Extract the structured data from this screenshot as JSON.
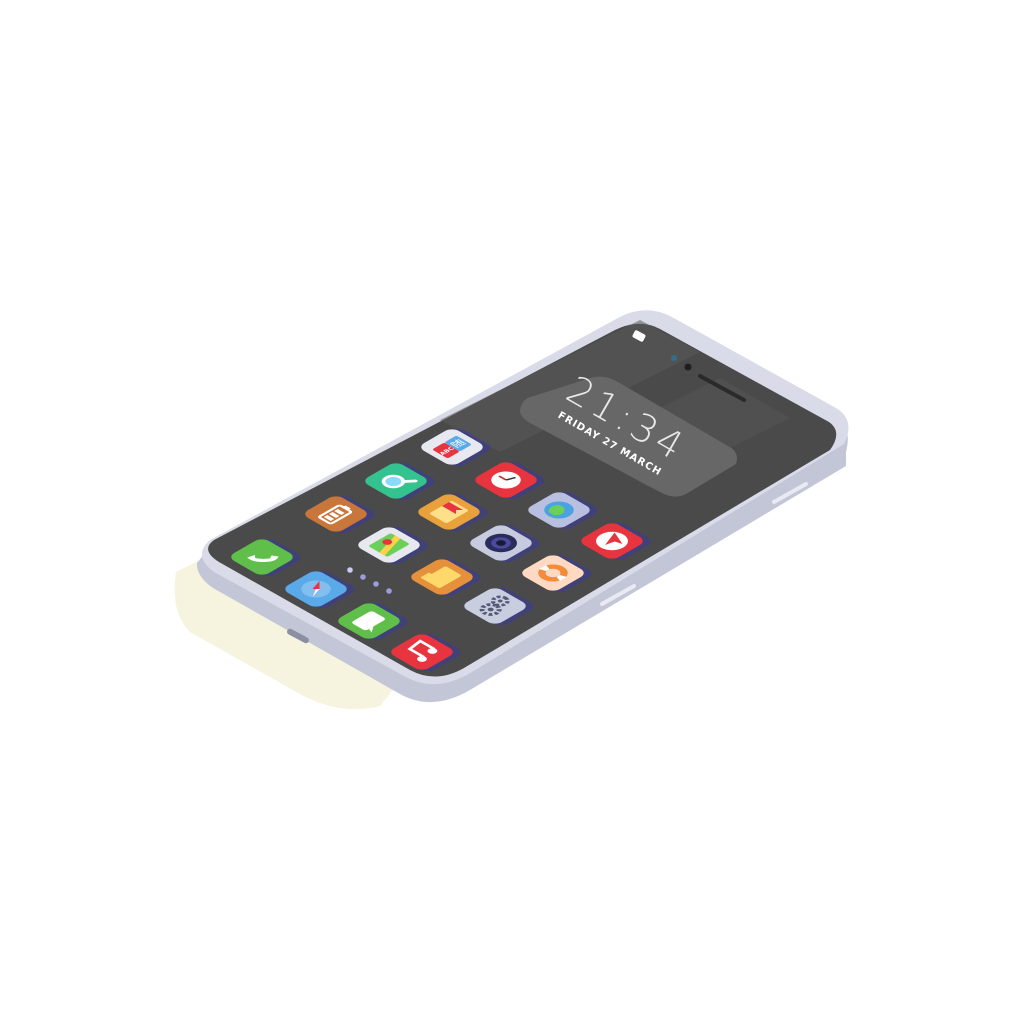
{
  "lock_widget": {
    "time": "21:34",
    "date": "FRIDAY 27 MARCH"
  },
  "translate_icon_text": {
    "latin": "ABC",
    "glyph": "随"
  },
  "colors": {
    "background": "#ffffff",
    "body_frame": "#d9dbe8",
    "body_edge": "#c3c6d6",
    "screen": "#4a4a4a",
    "shadow": "#f6f3de"
  },
  "page_indicator": {
    "dots": 4,
    "active": 0
  },
  "apps": [
    {
      "icon": "translate-icon",
      "bg": "#e8e8f0"
    },
    {
      "icon": "search-icon",
      "bg": "#34c38f"
    },
    {
      "icon": "clock-icon",
      "bg": "#e8343f"
    },
    {
      "icon": "battery-icon",
      "bg": "#c8763a"
    },
    {
      "icon": "bookmark-icon",
      "bg": "#e9a13b"
    },
    {
      "icon": "globe-icon",
      "bg": "#b9bfe0"
    },
    {
      "icon": "maps-icon",
      "bg": "#e8e8f0"
    },
    {
      "icon": "camera-icon",
      "bg": "#c7cbe0"
    },
    {
      "icon": "send-icon",
      "bg": "#e8343f"
    },
    {
      "icon": "phone-icon",
      "bg": "#5fbf4a"
    },
    {
      "icon": "folder-icon",
      "bg": "#e5903a"
    },
    {
      "icon": "lifebuoy-icon",
      "bg": "#ffd9c2"
    },
    {
      "icon": "compass-icon",
      "bg": "#5aa9e8"
    },
    {
      "icon": "settings-icon",
      "bg": "#c9cde0"
    },
    {
      "icon": "messages-icon",
      "bg": "#5fbf4a"
    },
    {
      "icon": "music-icon",
      "bg": "#e8343f"
    }
  ]
}
